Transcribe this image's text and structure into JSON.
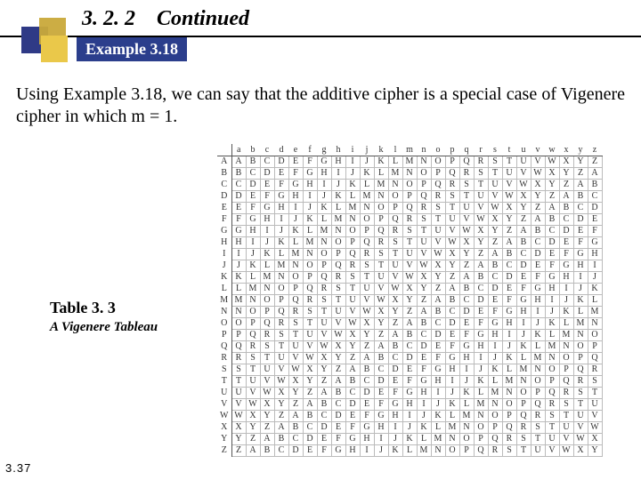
{
  "header": {
    "section": "3. 2. 2",
    "title": "Continued",
    "example_badge": "Example 3.18"
  },
  "body": "Using Example 3.18, we can say that the additive cipher is a special case of Vigenere cipher in which m = 1.",
  "table": {
    "label": "Table 3. 3",
    "caption": "A Vigenere Tableau"
  },
  "page_number": "3.37",
  "chart_data": {
    "type": "table",
    "title": "Vigenère Tableau",
    "col_headers": [
      "a",
      "b",
      "c",
      "d",
      "e",
      "f",
      "g",
      "h",
      "i",
      "j",
      "k",
      "l",
      "m",
      "n",
      "o",
      "p",
      "q",
      "r",
      "s",
      "t",
      "u",
      "v",
      "w",
      "x",
      "y",
      "z"
    ],
    "row_headers": [
      "A",
      "B",
      "C",
      "D",
      "E",
      "F",
      "G",
      "H",
      "I",
      "J",
      "K",
      "L",
      "M",
      "N",
      "O",
      "P",
      "Q",
      "R",
      "S",
      "T",
      "U",
      "V",
      "W",
      "X",
      "Y",
      "Z"
    ],
    "rows": [
      [
        "A",
        "B",
        "C",
        "D",
        "E",
        "F",
        "G",
        "H",
        "I",
        "J",
        "K",
        "L",
        "M",
        "N",
        "O",
        "P",
        "Q",
        "R",
        "S",
        "T",
        "U",
        "V",
        "W",
        "X",
        "Y",
        "Z"
      ],
      [
        "B",
        "C",
        "D",
        "E",
        "F",
        "G",
        "H",
        "I",
        "J",
        "K",
        "L",
        "M",
        "N",
        "O",
        "P",
        "Q",
        "R",
        "S",
        "T",
        "U",
        "V",
        "W",
        "X",
        "Y",
        "Z",
        "A"
      ],
      [
        "C",
        "D",
        "E",
        "F",
        "G",
        "H",
        "I",
        "J",
        "K",
        "L",
        "M",
        "N",
        "O",
        "P",
        "Q",
        "R",
        "S",
        "T",
        "U",
        "V",
        "W",
        "X",
        "Y",
        "Z",
        "A",
        "B"
      ],
      [
        "D",
        "E",
        "F",
        "G",
        "H",
        "I",
        "J",
        "K",
        "L",
        "M",
        "N",
        "O",
        "P",
        "Q",
        "R",
        "S",
        "T",
        "U",
        "V",
        "W",
        "X",
        "Y",
        "Z",
        "A",
        "B",
        "C"
      ],
      [
        "E",
        "F",
        "G",
        "H",
        "I",
        "J",
        "K",
        "L",
        "M",
        "N",
        "O",
        "P",
        "Q",
        "R",
        "S",
        "T",
        "U",
        "V",
        "W",
        "X",
        "Y",
        "Z",
        "A",
        "B",
        "C",
        "D"
      ],
      [
        "F",
        "G",
        "H",
        "I",
        "J",
        "K",
        "L",
        "M",
        "N",
        "O",
        "P",
        "Q",
        "R",
        "S",
        "T",
        "U",
        "V",
        "W",
        "X",
        "Y",
        "Z",
        "A",
        "B",
        "C",
        "D",
        "E"
      ],
      [
        "G",
        "H",
        "I",
        "J",
        "K",
        "L",
        "M",
        "N",
        "O",
        "P",
        "Q",
        "R",
        "S",
        "T",
        "U",
        "V",
        "W",
        "X",
        "Y",
        "Z",
        "A",
        "B",
        "C",
        "D",
        "E",
        "F"
      ],
      [
        "H",
        "I",
        "J",
        "K",
        "L",
        "M",
        "N",
        "O",
        "P",
        "Q",
        "R",
        "S",
        "T",
        "U",
        "V",
        "W",
        "X",
        "Y",
        "Z",
        "A",
        "B",
        "C",
        "D",
        "E",
        "F",
        "G"
      ],
      [
        "I",
        "J",
        "K",
        "L",
        "M",
        "N",
        "O",
        "P",
        "Q",
        "R",
        "S",
        "T",
        "U",
        "V",
        "W",
        "X",
        "Y",
        "Z",
        "A",
        "B",
        "C",
        "D",
        "E",
        "F",
        "G",
        "H"
      ],
      [
        "J",
        "K",
        "L",
        "M",
        "N",
        "O",
        "P",
        "Q",
        "R",
        "S",
        "T",
        "U",
        "V",
        "W",
        "X",
        "Y",
        "Z",
        "A",
        "B",
        "C",
        "D",
        "E",
        "F",
        "G",
        "H",
        "I"
      ],
      [
        "K",
        "L",
        "M",
        "N",
        "O",
        "P",
        "Q",
        "R",
        "S",
        "T",
        "U",
        "V",
        "W",
        "X",
        "Y",
        "Z",
        "A",
        "B",
        "C",
        "D",
        "E",
        "F",
        "G",
        "H",
        "I",
        "J"
      ],
      [
        "L",
        "M",
        "N",
        "O",
        "P",
        "Q",
        "R",
        "S",
        "T",
        "U",
        "V",
        "W",
        "X",
        "Y",
        "Z",
        "A",
        "B",
        "C",
        "D",
        "E",
        "F",
        "G",
        "H",
        "I",
        "J",
        "K"
      ],
      [
        "M",
        "N",
        "O",
        "P",
        "Q",
        "R",
        "S",
        "T",
        "U",
        "V",
        "W",
        "X",
        "Y",
        "Z",
        "A",
        "B",
        "C",
        "D",
        "E",
        "F",
        "G",
        "H",
        "I",
        "J",
        "K",
        "L"
      ],
      [
        "N",
        "O",
        "P",
        "Q",
        "R",
        "S",
        "T",
        "U",
        "V",
        "W",
        "X",
        "Y",
        "Z",
        "A",
        "B",
        "C",
        "D",
        "E",
        "F",
        "G",
        "H",
        "I",
        "J",
        "K",
        "L",
        "M"
      ],
      [
        "O",
        "P",
        "Q",
        "R",
        "S",
        "T",
        "U",
        "V",
        "W",
        "X",
        "Y",
        "Z",
        "A",
        "B",
        "C",
        "D",
        "E",
        "F",
        "G",
        "H",
        "I",
        "J",
        "K",
        "L",
        "M",
        "N"
      ],
      [
        "P",
        "Q",
        "R",
        "S",
        "T",
        "U",
        "V",
        "W",
        "X",
        "Y",
        "Z",
        "A",
        "B",
        "C",
        "D",
        "E",
        "F",
        "G",
        "H",
        "I",
        "J",
        "K",
        "L",
        "M",
        "N",
        "O"
      ],
      [
        "Q",
        "R",
        "S",
        "T",
        "U",
        "V",
        "W",
        "X",
        "Y",
        "Z",
        "A",
        "B",
        "C",
        "D",
        "E",
        "F",
        "G",
        "H",
        "I",
        "J",
        "K",
        "L",
        "M",
        "N",
        "O",
        "P"
      ],
      [
        "R",
        "S",
        "T",
        "U",
        "V",
        "W",
        "X",
        "Y",
        "Z",
        "A",
        "B",
        "C",
        "D",
        "E",
        "F",
        "G",
        "H",
        "I",
        "J",
        "K",
        "L",
        "M",
        "N",
        "O",
        "P",
        "Q"
      ],
      [
        "S",
        "T",
        "U",
        "V",
        "W",
        "X",
        "Y",
        "Z",
        "A",
        "B",
        "C",
        "D",
        "E",
        "F",
        "G",
        "H",
        "I",
        "J",
        "K",
        "L",
        "M",
        "N",
        "O",
        "P",
        "Q",
        "R"
      ],
      [
        "T",
        "U",
        "V",
        "W",
        "X",
        "Y",
        "Z",
        "A",
        "B",
        "C",
        "D",
        "E",
        "F",
        "G",
        "H",
        "I",
        "J",
        "K",
        "L",
        "M",
        "N",
        "O",
        "P",
        "Q",
        "R",
        "S"
      ],
      [
        "U",
        "V",
        "W",
        "X",
        "Y",
        "Z",
        "A",
        "B",
        "C",
        "D",
        "E",
        "F",
        "G",
        "H",
        "I",
        "J",
        "K",
        "L",
        "M",
        "N",
        "O",
        "P",
        "Q",
        "R",
        "S",
        "T"
      ],
      [
        "V",
        "W",
        "X",
        "Y",
        "Z",
        "A",
        "B",
        "C",
        "D",
        "E",
        "F",
        "G",
        "H",
        "I",
        "J",
        "K",
        "L",
        "M",
        "N",
        "O",
        "P",
        "Q",
        "R",
        "S",
        "T",
        "U"
      ],
      [
        "W",
        "X",
        "Y",
        "Z",
        "A",
        "B",
        "C",
        "D",
        "E",
        "F",
        "G",
        "H",
        "I",
        "J",
        "K",
        "L",
        "M",
        "N",
        "O",
        "P",
        "Q",
        "R",
        "S",
        "T",
        "U",
        "V"
      ],
      [
        "X",
        "Y",
        "Z",
        "A",
        "B",
        "C",
        "D",
        "E",
        "F",
        "G",
        "H",
        "I",
        "J",
        "K",
        "L",
        "M",
        "N",
        "O",
        "P",
        "Q",
        "R",
        "S",
        "T",
        "U",
        "V",
        "W"
      ],
      [
        "Y",
        "Z",
        "A",
        "B",
        "C",
        "D",
        "E",
        "F",
        "G",
        "H",
        "I",
        "J",
        "K",
        "L",
        "M",
        "N",
        "O",
        "P",
        "Q",
        "R",
        "S",
        "T",
        "U",
        "V",
        "W",
        "X"
      ],
      [
        "Z",
        "A",
        "B",
        "C",
        "D",
        "E",
        "F",
        "G",
        "H",
        "I",
        "J",
        "K",
        "L",
        "M",
        "N",
        "O",
        "P",
        "Q",
        "R",
        "S",
        "T",
        "U",
        "V",
        "W",
        "X",
        "Y"
      ]
    ]
  }
}
